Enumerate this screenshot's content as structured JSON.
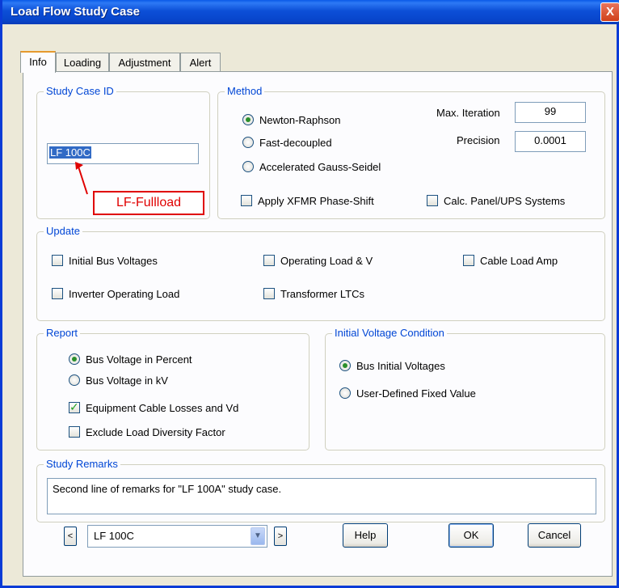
{
  "window": {
    "title": "Load Flow Study Case",
    "close_glyph": "X"
  },
  "tabs": [
    {
      "label": "Info",
      "active": true
    },
    {
      "label": "Loading",
      "active": false
    },
    {
      "label": "Adjustment",
      "active": false
    },
    {
      "label": "Alert",
      "active": false
    }
  ],
  "study_case_id": {
    "legend": "Study Case ID",
    "value": "LF 100C",
    "annotation": "LF-Fullload",
    "annotation_color": "#e00000"
  },
  "method": {
    "legend": "Method",
    "options": [
      {
        "label": "Newton-Raphson",
        "selected": true
      },
      {
        "label": "Fast-decoupled",
        "selected": false
      },
      {
        "label": "Accelerated Gauss-Seidel",
        "selected": false
      }
    ],
    "max_iteration_label": "Max. Iteration",
    "max_iteration_value": "99",
    "precision_label": "Precision",
    "precision_value": "0.0001",
    "apply_xfmr_label": "Apply XFMR Phase-Shift",
    "calc_panel_label": "Calc. Panel/UPS Systems"
  },
  "update": {
    "legend": "Update",
    "initial_bus_voltages": "Initial Bus Voltages",
    "operating_load_v": "Operating Load & V",
    "cable_load_amp": "Cable Load Amp",
    "inverter_operating_load": "Inverter Operating Load",
    "transformer_ltcs": "Transformer LTCs"
  },
  "report": {
    "legend": "Report",
    "bus_voltage_percent": "Bus Voltage in Percent",
    "bus_voltage_kv": "Bus Voltage in kV",
    "equipment_cable_losses": "Equipment Cable Losses and Vd",
    "exclude_load_diversity": "Exclude Load Diversity Factor"
  },
  "initial_voltage": {
    "legend": "Initial Voltage Condition",
    "bus_initial_voltages": "Bus Initial Voltages",
    "user_defined_fixed": "User-Defined Fixed Value"
  },
  "study_remarks": {
    "legend": "Study Remarks",
    "text": "Second line of remarks for \"LF 100A\" study case."
  },
  "footer": {
    "prev_glyph": "<",
    "next_glyph": ">",
    "case_select_value": "LF 100C",
    "help_label": "Help",
    "ok_label": "OK",
    "cancel_label": "Cancel"
  }
}
